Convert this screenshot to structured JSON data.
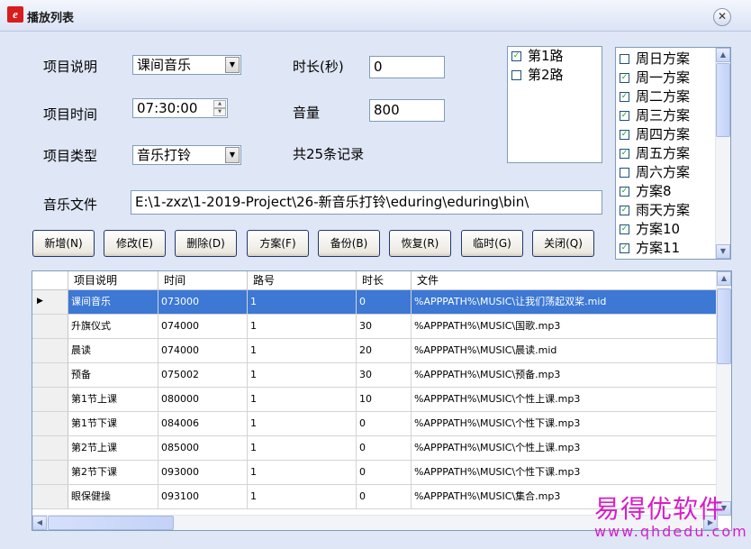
{
  "window": {
    "title": "播放列表",
    "close_glyph": "✕"
  },
  "form": {
    "item_desc_label": "项目说明",
    "item_desc_value": "课间音乐",
    "item_time_label": "项目时间",
    "item_time_value": "07:30:00",
    "item_type_label": "项目类型",
    "item_type_value": "音乐打铃",
    "duration_label": "时长(秒)",
    "duration_value": "0",
    "volume_label": "音量",
    "volume_value": "800",
    "record_count": "共25条记录",
    "music_file_label": "音乐文件",
    "music_file_value": "E:\\1-zxz\\1-2019-Project\\26-新音乐打铃\\eduring\\eduring\\bin\\"
  },
  "routes": [
    {
      "label": "第1路",
      "checked": true
    },
    {
      "label": "第2路",
      "checked": false
    }
  ],
  "plans": [
    {
      "label": "周日方案",
      "checked": false
    },
    {
      "label": "周一方案",
      "checked": true
    },
    {
      "label": "周二方案",
      "checked": true
    },
    {
      "label": "周三方案",
      "checked": true
    },
    {
      "label": "周四方案",
      "checked": true
    },
    {
      "label": "周五方案",
      "checked": true
    },
    {
      "label": "周六方案",
      "checked": false
    },
    {
      "label": "方案8",
      "checked": true
    },
    {
      "label": "雨天方案",
      "checked": true
    },
    {
      "label": "方案10",
      "checked": true
    },
    {
      "label": "方案11",
      "checked": true
    }
  ],
  "buttons": [
    {
      "name": "add-button",
      "label": "新增(N)"
    },
    {
      "name": "edit-button",
      "label": "修改(E)"
    },
    {
      "name": "delete-button",
      "label": "删除(D)"
    },
    {
      "name": "plan-button",
      "label": "方案(F)"
    },
    {
      "name": "backup-button",
      "label": "备份(B)"
    },
    {
      "name": "restore-button",
      "label": "恢复(R)"
    },
    {
      "name": "temp-button",
      "label": "临时(G)"
    },
    {
      "name": "close-button",
      "label": "关闭(Q)"
    }
  ],
  "table": {
    "columns": [
      "项目说明",
      "时间",
      "路号",
      "时长",
      "文件"
    ],
    "rows": [
      [
        "课间音乐",
        "073000",
        "1",
        "0",
        "%APPPATH%\\MUSIC\\让我们荡起双桨.mid"
      ],
      [
        "升旗仪式",
        "074000",
        "1",
        "30",
        "%APPPATH%\\MUSIC\\国歌.mp3"
      ],
      [
        "晨读",
        "074000",
        "1",
        "20",
        "%APPPATH%\\MUSIC\\晨读.mid"
      ],
      [
        "预备",
        "075002",
        "1",
        "30",
        "%APPPATH%\\MUSIC\\预备.mp3"
      ],
      [
        "第1节上课",
        "080000",
        "1",
        "10",
        "%APPPATH%\\MUSIC\\个性上课.mp3"
      ],
      [
        "第1节下课",
        "084006",
        "1",
        "0",
        "%APPPATH%\\MUSIC\\个性下课.mp3"
      ],
      [
        "第2节上课",
        "085000",
        "1",
        "0",
        "%APPPATH%\\MUSIC\\个性上课.mp3"
      ],
      [
        "第2节下课",
        "093000",
        "1",
        "0",
        "%APPPATH%\\MUSIC\\个性下课.mp3"
      ],
      [
        "眼保健操",
        "093100",
        "1",
        "0",
        "%APPPATH%\\MUSIC\\集合.mp3"
      ]
    ]
  },
  "watermark": {
    "line1": "易得优软件",
    "line2": "www.qhdedu.com"
  },
  "colors": {
    "selection": "#3c78d4",
    "watermark": "#d61ec8",
    "background": "#dfe6f6"
  }
}
